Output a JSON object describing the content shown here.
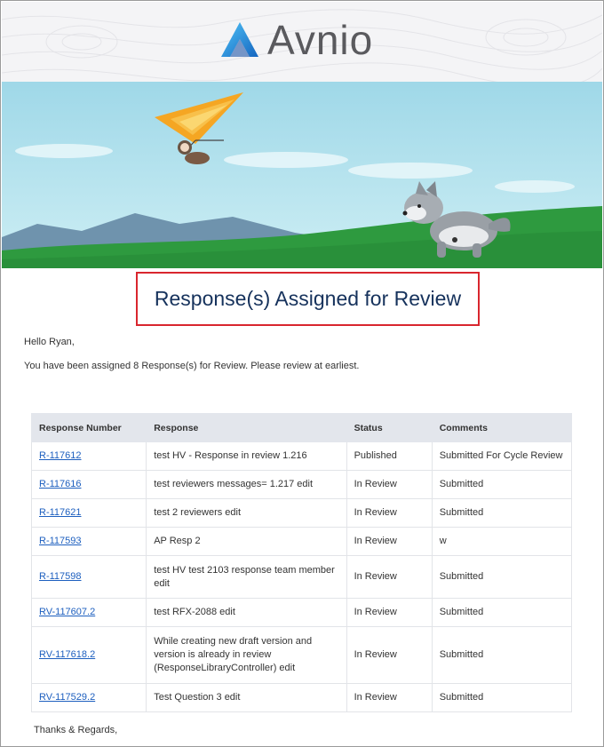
{
  "brand": {
    "name": "Avnio",
    "accent": "#2196f3"
  },
  "title": "Response(s) Assigned for Review",
  "greeting": "Hello Ryan,",
  "message": "You have been assigned 8 Response(s) for Review. Please review at earliest.",
  "table": {
    "headers": [
      "Response Number",
      "Response",
      "Status",
      "Comments"
    ],
    "rows": [
      {
        "number": "R-117612",
        "response": "test HV - Response in review 1.216",
        "status": "Published",
        "comments": "Submitted For Cycle Review"
      },
      {
        "number": "R-117616",
        "response": "test reviewers messages= 1.217 edit",
        "status": "In Review",
        "comments": "Submitted"
      },
      {
        "number": "R-117621",
        "response": "test 2 reviewers edit",
        "status": "In Review",
        "comments": "Submitted"
      },
      {
        "number": "R-117593",
        "response": "AP Resp 2",
        "status": "In Review",
        "comments": "w"
      },
      {
        "number": "R-117598",
        "response": "test HV test 2103 response team member edit",
        "status": "In Review",
        "comments": "Submitted"
      },
      {
        "number": "RV-117607.2",
        "response": "test RFX-2088 edit",
        "status": "In Review",
        "comments": "Submitted"
      },
      {
        "number": "RV-117618.2",
        "response": "While creating new draft version and version is already in review (ResponseLibraryController) edit",
        "status": "In Review",
        "comments": "Submitted"
      },
      {
        "number": "RV-117529.2",
        "response": "Test Question 3 edit",
        "status": "In Review",
        "comments": "Submitted"
      }
    ]
  },
  "closing": "Thanks & Regards,",
  "colors": {
    "title": "#16325c",
    "highlight_border": "#d9262e",
    "link": "#1d5fbf",
    "table_header_bg": "#e3e6ec",
    "sky": "#a9dcea",
    "grass": "#2e9a3f"
  }
}
